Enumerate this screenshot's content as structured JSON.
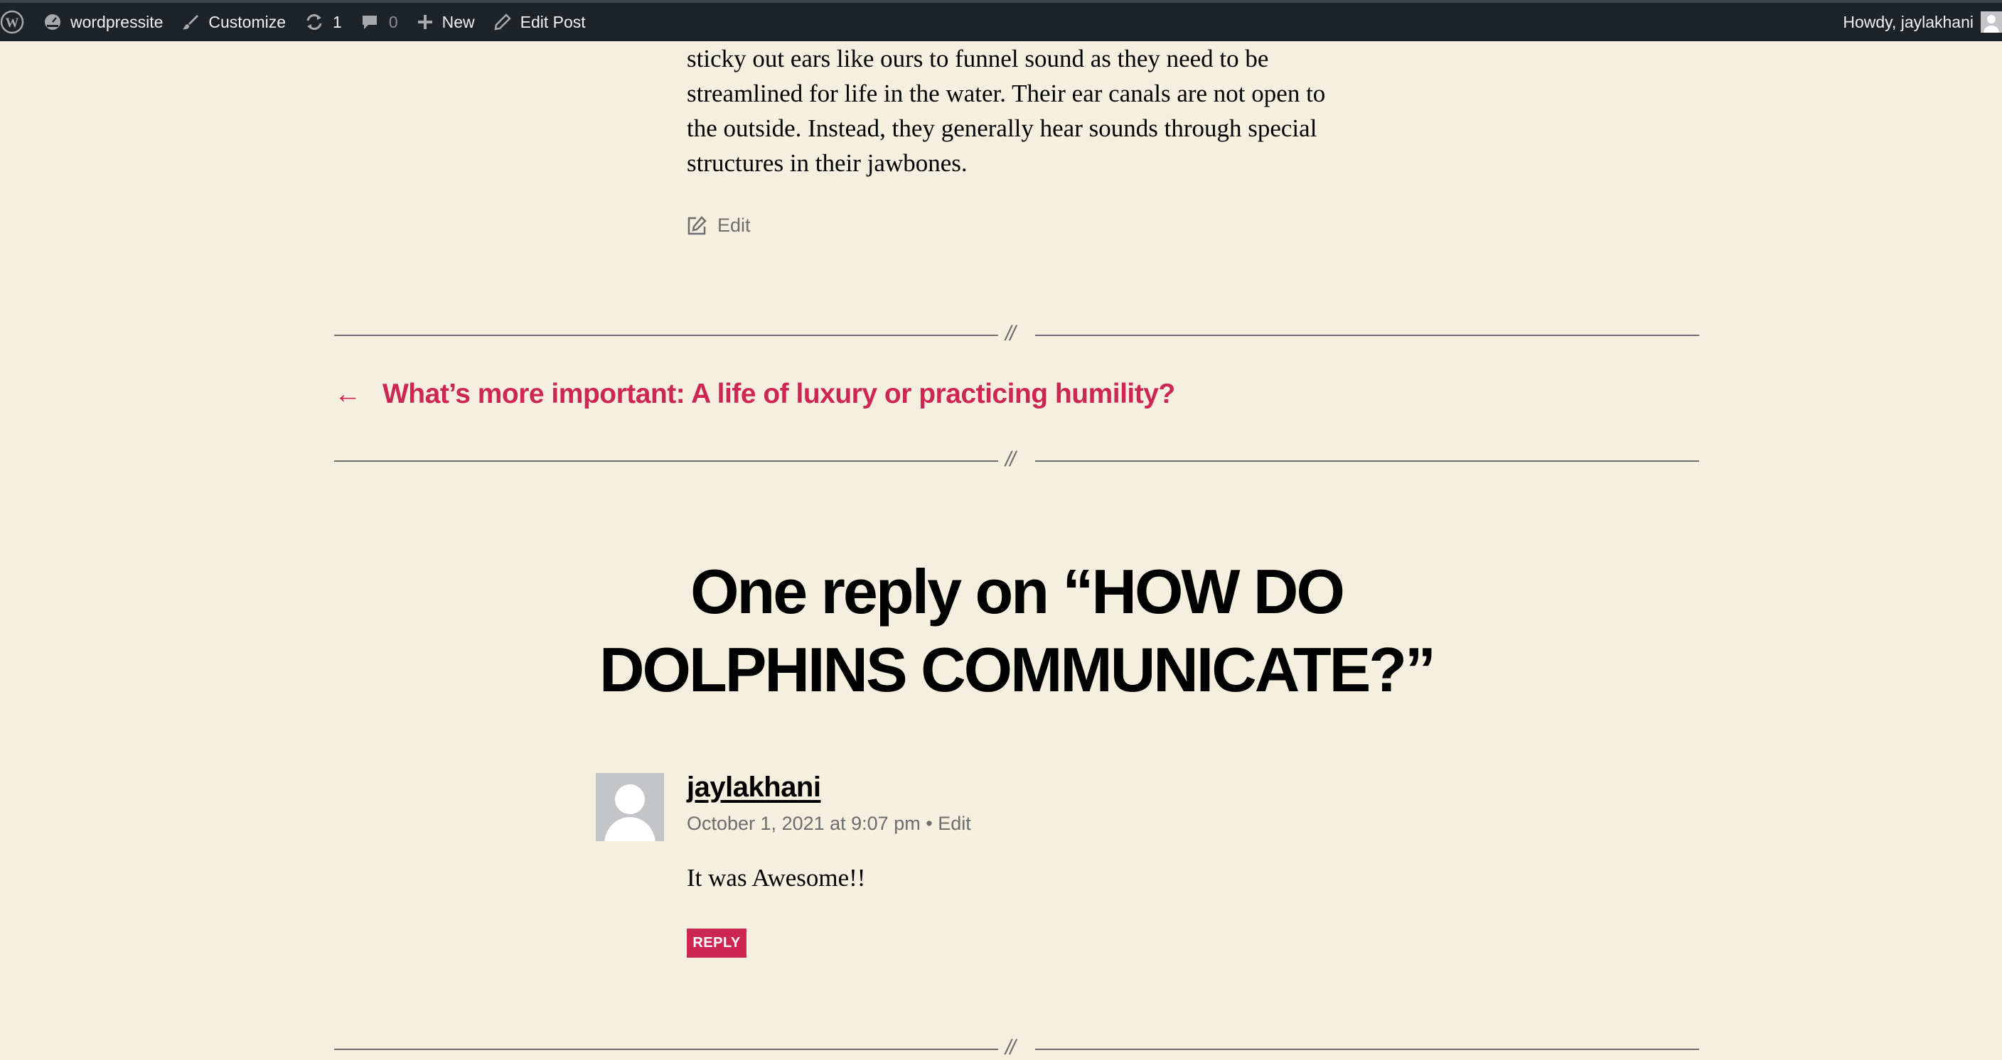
{
  "adminbar": {
    "site_name": "wordpressite",
    "customize": "Customize",
    "updates_count": "1",
    "comments_count": "0",
    "new": "New",
    "edit_post": "Edit Post",
    "howdy": "Howdy, jaylakhani"
  },
  "entry": {
    "lines": [
      "sticky out ears like ours to funnel sound as they need to be",
      "streamlined for life in the water. Their ear canals are not open to",
      "the outside. Instead, they generally hear sounds through special",
      "structures in their jawbones."
    ],
    "edit_label": "Edit"
  },
  "separator_text": "//",
  "post_nav": {
    "arrow": "←",
    "previous_title": "What’s more important: A life of luxury or practicing humility?"
  },
  "comments": {
    "heading_line1": "One reply on “HOW DO",
    "heading_line2": "DOLPHINS COMMUNICATE?”",
    "author": "jaylakhani",
    "date": "October 1, 2021 at 9:07 pm",
    "meta_sep": "•",
    "edit": "Edit",
    "text": "It was Awesome!!",
    "reply": "REPLY"
  },
  "colors": {
    "background": "#f5efe0",
    "accent": "#cd2653",
    "adminbar": "#1d2327"
  }
}
